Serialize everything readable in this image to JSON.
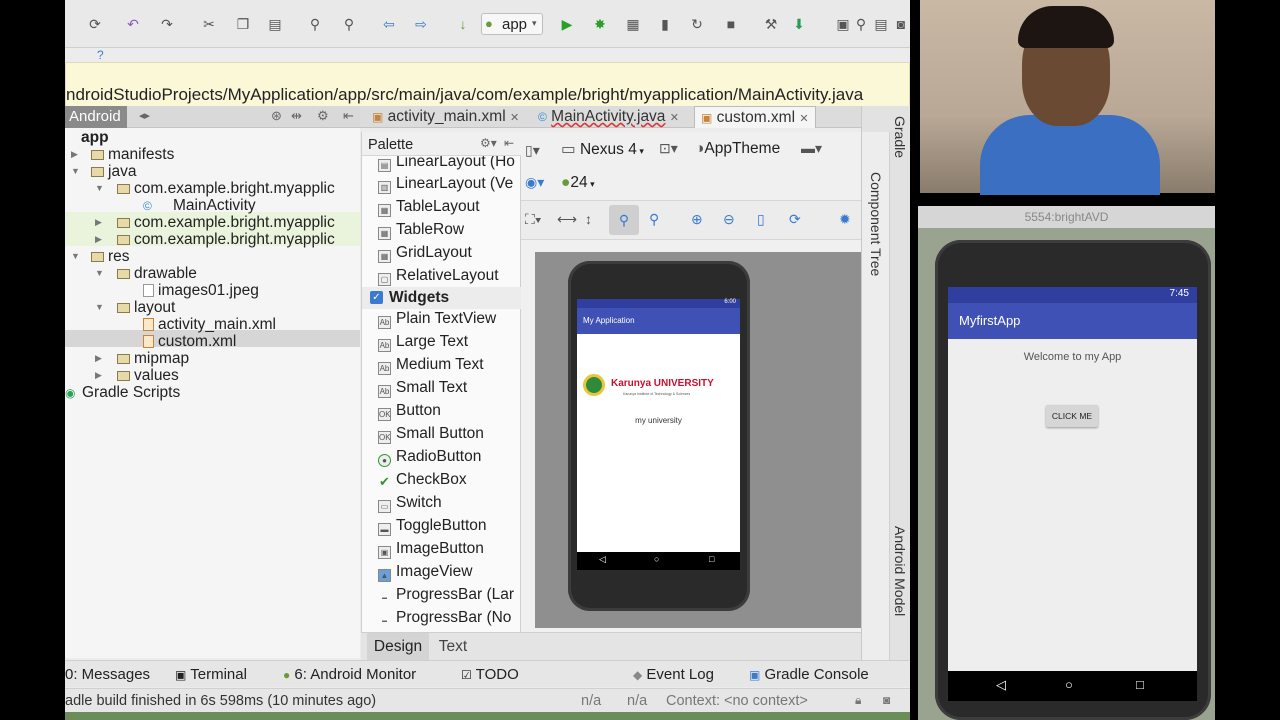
{
  "toolbar": {
    "run_config": "app",
    "help_label": "?"
  },
  "path": {
    "text": "ndroidStudioProjects/MyApplication/app/src/main/java/com/example/bright/myapplication/MainActivity.java"
  },
  "project": {
    "view_mode": "Android",
    "tree": [
      {
        "label": "app"
      },
      {
        "label": "manifests"
      },
      {
        "label": "java"
      },
      {
        "label": "com.example.bright.myapplic"
      },
      {
        "label": "MainActivity"
      },
      {
        "label": "com.example.bright.myapplic"
      },
      {
        "label": "com.example.bright.myapplic"
      },
      {
        "label": "res"
      },
      {
        "label": "drawable"
      },
      {
        "label": "images01.jpeg"
      },
      {
        "label": "layout"
      },
      {
        "label": "activity_main.xml"
      },
      {
        "label": "custom.xml"
      },
      {
        "label": "mipmap"
      },
      {
        "label": "values"
      },
      {
        "label": "Gradle Scripts"
      }
    ]
  },
  "tabs": [
    {
      "label": "activity_main.xml"
    },
    {
      "label": "MainActivity.java"
    },
    {
      "label": "custom.xml"
    }
  ],
  "palette": {
    "title": "Palette",
    "items": [
      {
        "label": "LinearLayout (Ho"
      },
      {
        "label": "LinearLayout (Ve"
      },
      {
        "label": "TableLayout"
      },
      {
        "label": "TableRow"
      },
      {
        "label": "GridLayout"
      },
      {
        "label": "RelativeLayout"
      },
      {
        "label": "Widgets"
      },
      {
        "label": "Plain TextView"
      },
      {
        "label": "Large Text"
      },
      {
        "label": "Medium Text"
      },
      {
        "label": "Small Text"
      },
      {
        "label": "Button"
      },
      {
        "label": "Small Button"
      },
      {
        "label": "RadioButton"
      },
      {
        "label": "CheckBox"
      },
      {
        "label": "Switch"
      },
      {
        "label": "ToggleButton"
      },
      {
        "label": "ImageButton"
      },
      {
        "label": "ImageView"
      },
      {
        "label": "ProgressBar (Lar"
      },
      {
        "label": "ProgressBar (No"
      }
    ]
  },
  "designer": {
    "device": "Nexus 4",
    "theme": "AppTheme",
    "api": "24",
    "preview": {
      "status_time": "6:00",
      "app_title": "My Application",
      "logo_text": "Karunya UNIVERSITY",
      "logo_sub": "Karunya Institute of Technology & Sciences",
      "caption": "my university"
    },
    "mode_tabs": [
      {
        "label": "Design"
      },
      {
        "label": "Text"
      }
    ]
  },
  "side_panels": {
    "gradle": "Gradle",
    "component_tree": "Component Tree",
    "android_model": "Android Model"
  },
  "bottom_tools": [
    {
      "label": "0: Messages"
    },
    {
      "label": "Terminal"
    },
    {
      "label": "6: Android Monitor"
    },
    {
      "label": "TODO"
    },
    {
      "label": "Event Log"
    },
    {
      "label": "Gradle Console"
    }
  ],
  "status": {
    "message": "adle build finished in 6s 598ms (10 minutes ago)",
    "pos1": "n/a",
    "pos2": "n/a",
    "context": "Context: <no context>"
  },
  "emulator": {
    "window_title": "5554:brightAVD",
    "time": "7:45",
    "app_title": "MyfirstApp",
    "welcome": "Welcome to my App",
    "button": "CLICK ME"
  },
  "colors": {
    "app_bar": "#3f51b5",
    "status_bar": "#303f9f",
    "path_bar_bg": "#fbf8d8",
    "selected_row": "#d6d6d6",
    "highlight_row": "#eaf3dc"
  }
}
